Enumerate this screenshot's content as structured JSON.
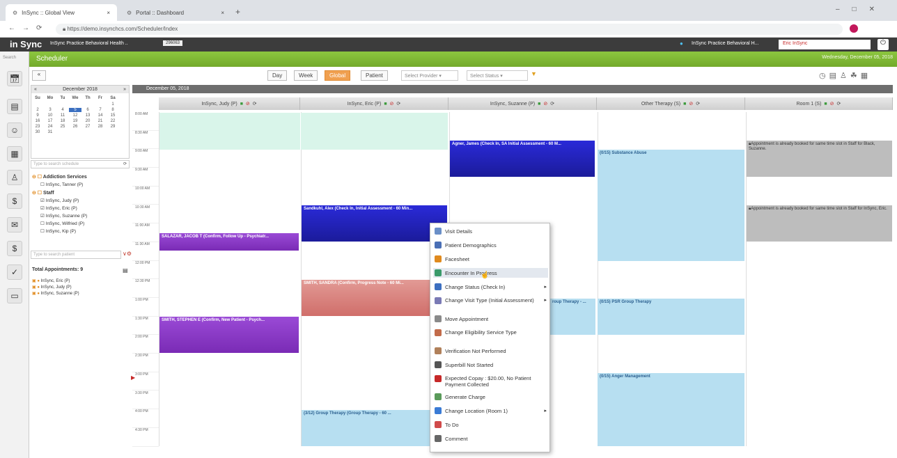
{
  "browser": {
    "tabs": [
      {
        "title": "InSync :: Global View",
        "close": "×"
      },
      {
        "title": "Portal :: Dashboard",
        "close": "×"
      }
    ],
    "new_tab": "+",
    "url": "https://demo.insynchcs.com/Scheduler/Index"
  },
  "header": {
    "logo": "in Sync",
    "practice_title": "InSync Practice Behavioral Health ..",
    "badge": "296063",
    "location": "InSync Practice Behavioral H...",
    "user": "Eric InSync",
    "search_label": "Search"
  },
  "module": {
    "title": "Scheduler",
    "date": "Wednesday, December 05, 2018"
  },
  "toolbar": {
    "views": [
      "Day",
      "Week",
      "Global",
      "Patient"
    ],
    "active_view": "Global",
    "provider_placeholder": "Select Provider",
    "status_placeholder": "Select Status"
  },
  "minical": {
    "month": "December 2018",
    "weekdays": [
      "Su",
      "Mo",
      "Tu",
      "We",
      "Th",
      "Fr",
      "Sa"
    ],
    "weeks": [
      [
        "",
        "",
        "",
        "",
        "",
        "",
        "1"
      ],
      [
        "2",
        "3",
        "4",
        "5",
        "6",
        "7",
        "8"
      ],
      [
        "9",
        "10",
        "11",
        "12",
        "13",
        "14",
        "15"
      ],
      [
        "16",
        "17",
        "18",
        "19",
        "20",
        "21",
        "22"
      ],
      [
        "23",
        "24",
        "25",
        "26",
        "27",
        "28",
        "29"
      ],
      [
        "30",
        "31",
        "",
        "",
        "",
        "",
        ""
      ]
    ],
    "selected": "5"
  },
  "filters": {
    "schedule_search_placeholder": "Type to search schedule",
    "groups": [
      {
        "name": "Addiction Services",
        "items": [
          {
            "label": "InSync, Tanner (P)",
            "checked": false
          }
        ]
      },
      {
        "name": "Staff",
        "items": [
          {
            "label": "InSync, Judy (P)",
            "checked": true
          },
          {
            "label": "InSync, Eric (P)",
            "checked": true
          },
          {
            "label": "InSync, Suzanne (P)",
            "checked": true
          },
          {
            "label": "InSync, Wilfried (P)",
            "checked": false
          },
          {
            "label": "InSync, Kip (P)",
            "checked": false
          }
        ]
      }
    ],
    "patient_search_placeholder": "Type to search patient",
    "total_label": "Total Appointments: 9",
    "totals": [
      "InSync, Eric (P)",
      "InSync, Judy (P)",
      "InSync, Suzanne (P)"
    ]
  },
  "schedule": {
    "day_label": "December 05, 2018",
    "columns": [
      "InSync, Judy (P)",
      "InSync, Eric (P)",
      "InSync, Suzanne (P)",
      "Other Therapy (S)",
      "Room 1 (S)"
    ],
    "times": [
      "8:00 AM",
      "8:30 AM",
      "9:00 AM",
      "9:30 AM",
      "10:00 AM",
      "10:30 AM",
      "11:00 AM",
      "11:30 AM",
      "12:00 PM",
      "12:30 PM",
      "1:00 PM",
      "1:30 PM",
      "2:00 PM",
      "2:30 PM",
      "3:00 PM",
      "3:30 PM",
      "4:00 PM",
      "4:30 PM"
    ],
    "appointments": {
      "agner": "Agner, James (Check In, SA Initial Assessment - 60 M...",
      "sandkuhl": "Sandkuhl, Alex (Check In, Initial Assessment - 60 Min...",
      "salazar": "SALAZAR, JACOB T (Confirm, Follow Up - Psychiatr...",
      "smith_sandra": "SMITH, SANDRA (Confirm, Progress Note - 60 Mi...",
      "smith_stephen": "SMITH, STEPHEN E (Confirm, New Patient - Psych...",
      "group_therapy_eric": "(3/12) Group Therapy (Group Therapy - 60 ...",
      "substance_abuse": "(0/15) Substance Abuse",
      "group_therapy_suzanne": "roup Therapy - ...",
      "psr_group": "(0/15) PSR Group Therapy",
      "anger": "(0/15) Anger Management",
      "room_note_1": "Appointment is already booked for same time slot in Staff for Black, Suzanne.",
      "room_note_2": "Appointment is already booked for same time slot in Staff for InSync, Eric."
    }
  },
  "context_menu": [
    {
      "label": "Visit Details",
      "icon": "visit-details-icon",
      "color": "#6a8fc7"
    },
    {
      "label": "Patient Demographics",
      "icon": "patient-icon",
      "color": "#4a6fb5"
    },
    {
      "label": "Facesheet",
      "icon": "facesheet-icon",
      "color": "#e08a1e"
    },
    {
      "label": "Encounter In Progress",
      "icon": "encounter-icon",
      "color": "#3a9a6a",
      "highlight": true
    },
    {
      "label": "Change Status (Check In)",
      "icon": "status-icon",
      "color": "#3c6fc0",
      "submenu": true
    },
    {
      "label": "Change Visit Type (Initial Assessment)",
      "icon": "visit-type-icon",
      "color": "#7a7ab5",
      "submenu": true
    },
    {
      "label": "Move Appointment",
      "icon": "move-icon",
      "color": "#8a8a8a"
    },
    {
      "label": "Change Eligibility Service Type",
      "icon": "eligibility-icon",
      "color": "#c26b4a"
    },
    {
      "label": "Verification Not Performed",
      "icon": "verification-icon",
      "color": "#b0805a"
    },
    {
      "label": "Superbill Not Started",
      "icon": "superbill-icon",
      "color": "#555555"
    },
    {
      "label": "Expected Copay : $20.00, No Patient Payment Collected",
      "icon": "copay-icon",
      "color": "#c62828"
    },
    {
      "label": "Generate Charge",
      "icon": "charge-icon",
      "color": "#5a9a5a"
    },
    {
      "label": "Change Location (Room 1)",
      "icon": "location-icon",
      "color": "#3a7bd5",
      "submenu": true
    },
    {
      "label": "To Do",
      "icon": "todo-icon",
      "color": "#d04a4a"
    },
    {
      "label": "Comment",
      "icon": "comment-icon",
      "color": "#666666"
    }
  ]
}
